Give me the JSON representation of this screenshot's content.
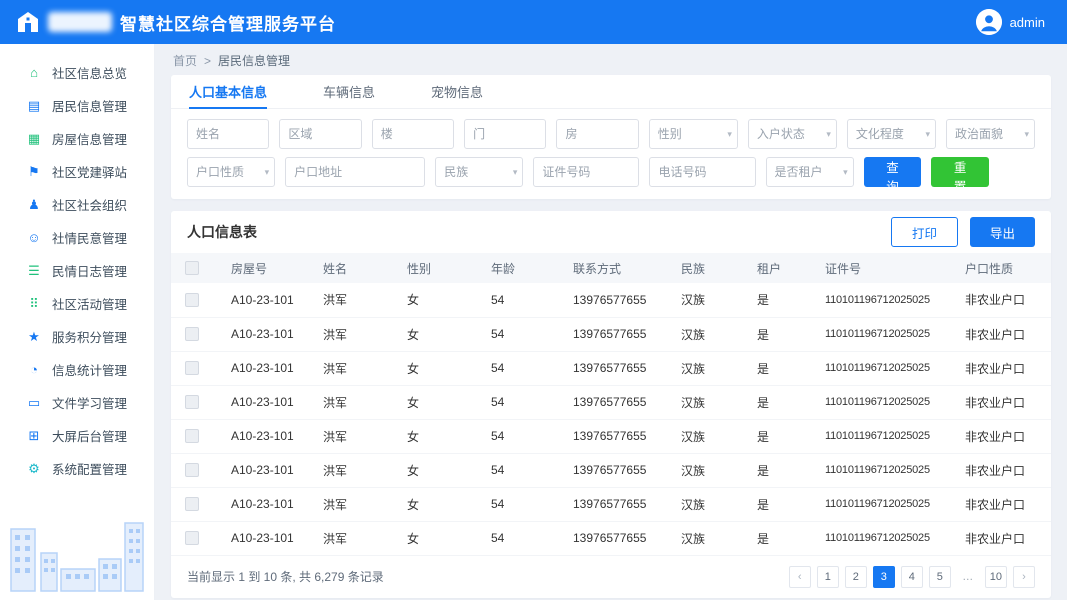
{
  "colors": {
    "primary": "#1678f2",
    "success_green": "#32c435",
    "sidebar_icon_green": "#21c17c",
    "sidebar_icon_teal": "#18b8c9"
  },
  "header": {
    "title": "智慧社区综合管理服务平台",
    "user": {
      "name": "admin"
    }
  },
  "sidebar": {
    "items": [
      {
        "name": "sidebar-item-overview",
        "icon": "overview-icon",
        "glyph": "⌂",
        "color": "#21c17c",
        "label": "社区信息总览"
      },
      {
        "name": "sidebar-item-resident-info",
        "icon": "resident-card-icon",
        "glyph": "▤",
        "color": "#1678f2",
        "label": "居民信息管理"
      },
      {
        "name": "sidebar-item-house-info",
        "icon": "building-icon",
        "glyph": "▦",
        "color": "#21c17c",
        "label": "房屋信息管理"
      },
      {
        "name": "sidebar-item-party-station",
        "icon": "flag-icon",
        "glyph": "⚑",
        "color": "#1678f2",
        "label": "社区党建驿站"
      },
      {
        "name": "sidebar-item-social-org",
        "icon": "group-icon",
        "glyph": "♟",
        "color": "#1678f2",
        "label": "社区社会组织"
      },
      {
        "name": "sidebar-item-public-opinion",
        "icon": "chat-icon",
        "glyph": "☺",
        "color": "#1678f2",
        "label": "社情民意管理"
      },
      {
        "name": "sidebar-item-civil-log",
        "icon": "journal-icon",
        "glyph": "☰",
        "color": "#21c17c",
        "label": "民情日志管理"
      },
      {
        "name": "sidebar-item-activity",
        "icon": "grid-icon",
        "glyph": "⠿",
        "color": "#21c17c",
        "label": "社区活动管理"
      },
      {
        "name": "sidebar-item-service-points",
        "icon": "star-icon",
        "glyph": "★",
        "color": "#1678f2",
        "label": "服务积分管理"
      },
      {
        "name": "sidebar-item-statistics",
        "icon": "pie-chart-icon",
        "glyph": "◔",
        "color": "#1678f2",
        "label": "信息统计管理"
      },
      {
        "name": "sidebar-item-document-study",
        "icon": "folder-icon",
        "glyph": "▭",
        "color": "#1678f2",
        "label": "文件学习管理"
      },
      {
        "name": "sidebar-item-screen-admin",
        "icon": "monitor-icon",
        "glyph": "⊞",
        "color": "#1678f2",
        "label": "大屏后台管理"
      },
      {
        "name": "sidebar-item-system-config",
        "icon": "gear-icon",
        "glyph": "⚙",
        "color": "#18b8c9",
        "label": "系统配置管理"
      }
    ]
  },
  "breadcrumb": {
    "home": "首页",
    "separator": ">",
    "current": "居民信息管理"
  },
  "tabs": [
    {
      "name": "tab-population-info",
      "label": "人口基本信息",
      "active": true
    },
    {
      "name": "tab-vehicle-info",
      "label": "车辆信息",
      "active": false
    },
    {
      "name": "tab-pet-info",
      "label": "宠物信息",
      "active": false
    }
  ],
  "filters": {
    "row1": [
      {
        "name": "name-filter",
        "placeholder": "姓名",
        "type": "input"
      },
      {
        "name": "region-filter",
        "placeholder": "区域",
        "type": "input"
      },
      {
        "name": "building-filter",
        "placeholder": "楼",
        "type": "input"
      },
      {
        "name": "unit-filter",
        "placeholder": "门",
        "type": "input"
      },
      {
        "name": "room-filter",
        "placeholder": "房",
        "type": "input"
      },
      {
        "name": "gender-select",
        "placeholder": "性别",
        "type": "select"
      },
      {
        "name": "household-status-select",
        "placeholder": "入户状态",
        "type": "select"
      },
      {
        "name": "education-select",
        "placeholder": "文化程度",
        "type": "select"
      },
      {
        "name": "political-status-select",
        "placeholder": "政治面貌",
        "type": "select"
      }
    ],
    "row2": [
      {
        "name": "household-type-select",
        "placeholder": "户口性质",
        "type": "select"
      },
      {
        "name": "household-address-filter",
        "placeholder": "户口地址",
        "type": "input",
        "size": "lg"
      },
      {
        "name": "ethnicity-select",
        "placeholder": "民族",
        "type": "select"
      },
      {
        "name": "id-number-filter",
        "placeholder": "证件号码",
        "type": "input",
        "size": "md"
      },
      {
        "name": "phone-filter",
        "placeholder": "电话号码",
        "type": "input",
        "size": "md"
      },
      {
        "name": "tenant-select",
        "placeholder": "是否租户",
        "type": "select"
      }
    ],
    "search_label": "查询",
    "reset_label": "重置"
  },
  "table": {
    "title": "人口信息表",
    "print_label": "打印",
    "export_label": "导出",
    "columns": [
      "房屋号",
      "姓名",
      "性别",
      "年龄",
      "联系方式",
      "民族",
      "租户",
      "证件号",
      "户口性质"
    ],
    "rows": [
      {
        "house_no": "A10-23-101",
        "name": "洪军",
        "gender": "女",
        "age": "54",
        "phone": "13976577655",
        "ethnicity": "汉族",
        "tenant": "是",
        "id_number": "110101196712025025",
        "household_type": "非农业户口"
      },
      {
        "house_no": "A10-23-101",
        "name": "洪军",
        "gender": "女",
        "age": "54",
        "phone": "13976577655",
        "ethnicity": "汉族",
        "tenant": "是",
        "id_number": "110101196712025025",
        "household_type": "非农业户口"
      },
      {
        "house_no": "A10-23-101",
        "name": "洪军",
        "gender": "女",
        "age": "54",
        "phone": "13976577655",
        "ethnicity": "汉族",
        "tenant": "是",
        "id_number": "110101196712025025",
        "household_type": "非农业户口"
      },
      {
        "house_no": "A10-23-101",
        "name": "洪军",
        "gender": "女",
        "age": "54",
        "phone": "13976577655",
        "ethnicity": "汉族",
        "tenant": "是",
        "id_number": "110101196712025025",
        "household_type": "非农业户口"
      },
      {
        "house_no": "A10-23-101",
        "name": "洪军",
        "gender": "女",
        "age": "54",
        "phone": "13976577655",
        "ethnicity": "汉族",
        "tenant": "是",
        "id_number": "110101196712025025",
        "household_type": "非农业户口"
      },
      {
        "house_no": "A10-23-101",
        "name": "洪军",
        "gender": "女",
        "age": "54",
        "phone": "13976577655",
        "ethnicity": "汉族",
        "tenant": "是",
        "id_number": "110101196712025025",
        "household_type": "非农业户口"
      },
      {
        "house_no": "A10-23-101",
        "name": "洪军",
        "gender": "女",
        "age": "54",
        "phone": "13976577655",
        "ethnicity": "汉族",
        "tenant": "是",
        "id_number": "110101196712025025",
        "household_type": "非农业户口"
      },
      {
        "house_no": "A10-23-101",
        "name": "洪军",
        "gender": "女",
        "age": "54",
        "phone": "13976577655",
        "ethnicity": "汉族",
        "tenant": "是",
        "id_number": "110101196712025025",
        "household_type": "非农业户口"
      }
    ]
  },
  "summary": "当前显示 1 到 10 条, 共 6,279 条记录",
  "pagination": {
    "prev_label": "‹",
    "next_label": "›",
    "pages": [
      {
        "label": "1"
      },
      {
        "label": "2"
      },
      {
        "label": "3",
        "active": true
      },
      {
        "label": "4"
      },
      {
        "label": "5"
      },
      {
        "label": "…",
        "ellipsis": true
      },
      {
        "label": "10"
      }
    ]
  }
}
